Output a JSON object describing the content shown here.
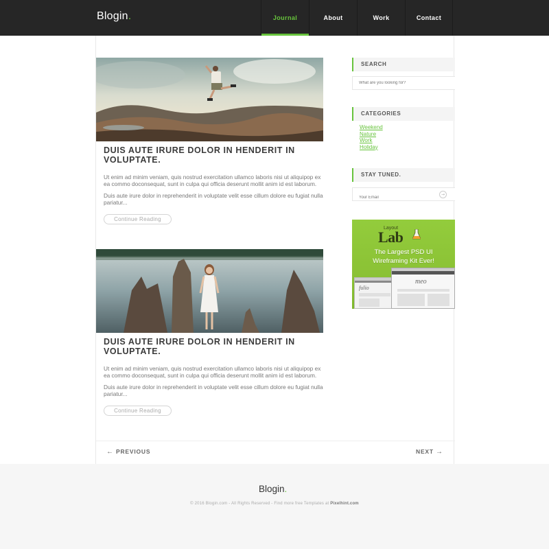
{
  "header": {
    "logo_text": "Blogin",
    "logo_dot": ".",
    "nav": [
      {
        "label": "Journal",
        "active": true
      },
      {
        "label": "About",
        "active": false
      },
      {
        "label": "Work",
        "active": false
      },
      {
        "label": "Contact",
        "active": false
      }
    ]
  },
  "posts": [
    {
      "image_icon": "photo-jumping-person-icon",
      "title": "DUIS AUTE IRURE DOLOR IN HENDERIT IN VOLUPTATE.",
      "paragraph1": "Ut enim ad minim veniam, quis nostrud exercitation ullamco laboris nisi ut aliquipop ex ea commo doconsequat, sunt in culpa qui officia deserunt mollit anim id est laborum.",
      "paragraph2": "Duis aute irure dolor in reprehenderit in voluptate velit esse cillum dolore eu fugiat nulla pariatur...",
      "read_more": "Continue Reading"
    },
    {
      "image_icon": "photo-woman-lake-icon",
      "title": "DUIS AUTE IRURE DOLOR IN HENDERIT IN VOLUPTATE.",
      "paragraph1": "Ut enim ad minim veniam, quis nostrud exercitation ullamco laboris nisi ut aliquipop ex ea commo doconsequat, sunt in culpa qui officia deserunt mollit anim id est laborum.",
      "paragraph2": "Duis aute irure dolor in reprehenderit in voluptate velit esse cillum dolore eu fugiat nulla pariatur...",
      "read_more": "Continue Reading"
    }
  ],
  "sidebar": {
    "search": {
      "heading": "SEARCH",
      "placeholder": "What are you looking for?"
    },
    "categories": {
      "heading": "CATEGORIES",
      "items": [
        "Weekend",
        "Nature",
        "Work",
        "Holiday"
      ]
    },
    "newsletter": {
      "heading": "STAY TUNED.",
      "placeholder": "Your Email",
      "submit_icon": "arrow-right-icon"
    },
    "ad": {
      "small_text": "Layout",
      "big_text": "Lab",
      "tagline": "The Largest PSD UI Wireframing Kit Ever!",
      "screen1_logo": "fulio",
      "screen2_logo": "meo"
    }
  },
  "pagination": {
    "previous": "PREVIOUS",
    "next": "NEXT",
    "prev_arrow": "←",
    "next_arrow": "→"
  },
  "footer": {
    "logo_text": "Blogin",
    "logo_dot": ".",
    "copyright": "© 2016 Blogin.com  -  All Rights Reserved  -  Find more free Templates at",
    "credit": "Pixelhint.com"
  },
  "colors": {
    "accent": "#67c33c",
    "header_bg": "#262626",
    "footer_bg": "#f6f6f6"
  }
}
